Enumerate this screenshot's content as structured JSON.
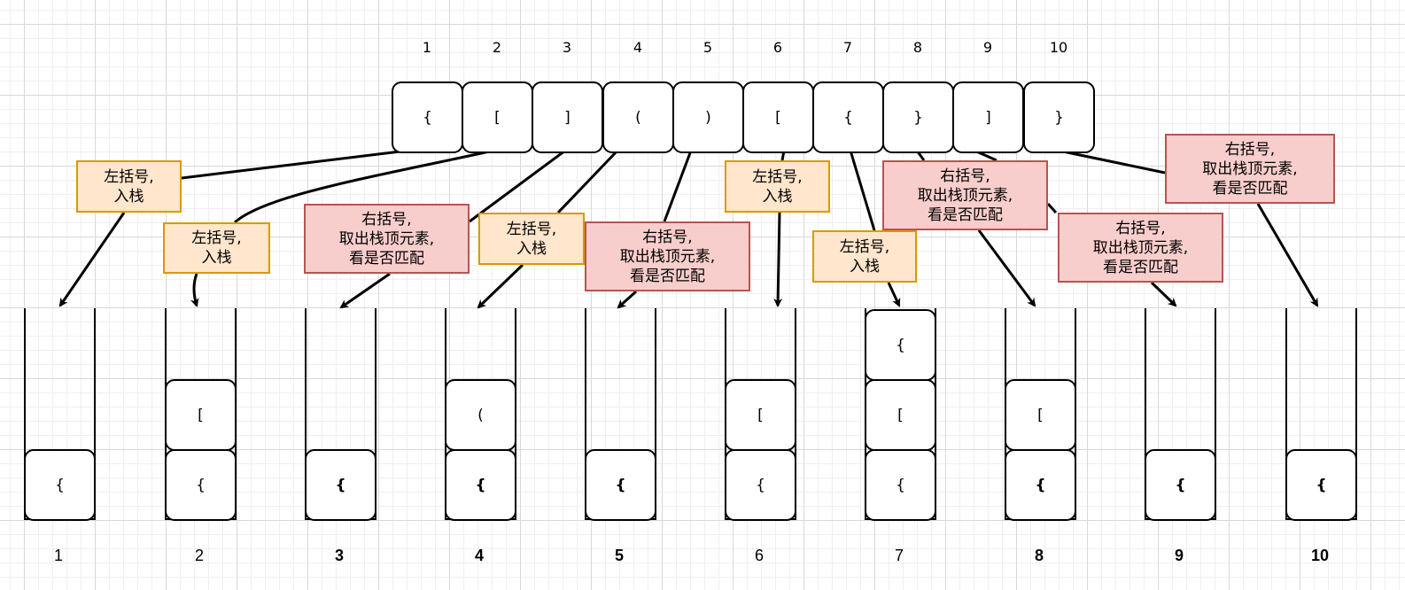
{
  "input": {
    "indices": [
      "1",
      "2",
      "3",
      "4",
      "5",
      "6",
      "7",
      "8",
      "9",
      "10"
    ],
    "chars": [
      "{",
      "[",
      "]",
      "(",
      ")",
      "[",
      "{",
      "}",
      "]",
      "}"
    ]
  },
  "notes": [
    {
      "text": "左括号,\n入栈",
      "type": "push"
    },
    {
      "text": "左括号,\n入栈",
      "type": "push"
    },
    {
      "text": "右括号,\n取出栈顶元素,\n看是否匹配",
      "type": "pop"
    },
    {
      "text": "左括号,\n入栈",
      "type": "push"
    },
    {
      "text": "右括号,\n取出栈顶元素,\n看是否匹配",
      "type": "pop"
    },
    {
      "text": "左括号,\n入栈",
      "type": "push"
    },
    {
      "text": "左括号,\n入栈",
      "type": "push"
    },
    {
      "text": "右括号,\n取出栈顶元素,\n看是否匹配",
      "type": "pop"
    },
    {
      "text": "右括号,\n取出栈顶元素,\n看是否匹配",
      "type": "pop"
    },
    {
      "text": "右括号,\n取出栈顶元素,\n看是否匹配",
      "type": "pop"
    }
  ],
  "stacks": [
    {
      "label": "1",
      "items": [
        "{"
      ],
      "bold": false
    },
    {
      "label": "2",
      "items": [
        "{",
        "["
      ],
      "bold": false
    },
    {
      "label": "3",
      "items": [
        "{"
      ],
      "bold": true
    },
    {
      "label": "4",
      "items": [
        "{",
        "("
      ],
      "bold": true
    },
    {
      "label": "5",
      "items": [
        "{"
      ],
      "bold": true
    },
    {
      "label": "6",
      "items": [
        "{",
        "["
      ],
      "bold": false
    },
    {
      "label": "7",
      "items": [
        "{",
        "[",
        "{"
      ],
      "bold": false
    },
    {
      "label": "8",
      "items": [
        "{",
        "["
      ],
      "bold": true
    },
    {
      "label": "9",
      "items": [
        "{"
      ],
      "bold": true
    },
    {
      "label": "10",
      "items": [
        "{"
      ],
      "bold": true
    }
  ],
  "colors": {
    "push_fill": "#ffe6cc",
    "push_stroke": "#d79b00",
    "pop_fill": "#f8cecc",
    "pop_stroke": "#b85450"
  }
}
